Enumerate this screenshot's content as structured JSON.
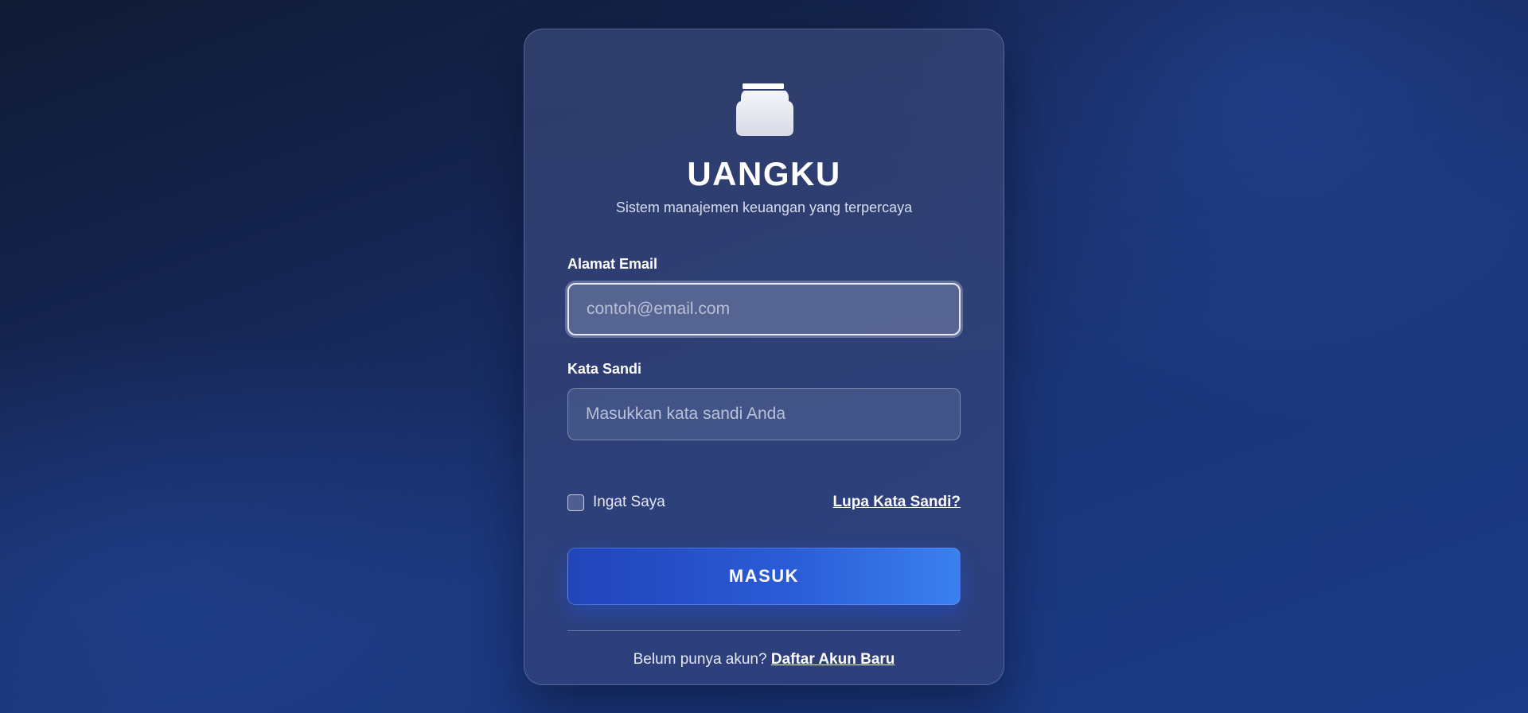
{
  "brand": {
    "logo_icon": "jar-icon",
    "name": "UANGKU",
    "tagline": "Sistem manajemen keuangan yang terpercaya"
  },
  "form": {
    "email_label": "Alamat Email",
    "email_placeholder": "contoh@email.com",
    "email_value": "",
    "password_label": "Kata Sandi",
    "password_placeholder": "Masukkan kata sandi Anda",
    "password_value": "",
    "remember_label": "Ingat Saya",
    "remember_checked": false,
    "forgot_link": "Lupa Kata Sandi?",
    "submit_label": "MASUK"
  },
  "footer": {
    "prompt": "Belum punya akun?",
    "register_link": "Daftar Akun Baru"
  },
  "colors": {
    "accent_start": "#2144b9",
    "accent_end": "#3a80ef",
    "background_dark": "#0f1a33",
    "background_blue": "#1b3b87"
  }
}
